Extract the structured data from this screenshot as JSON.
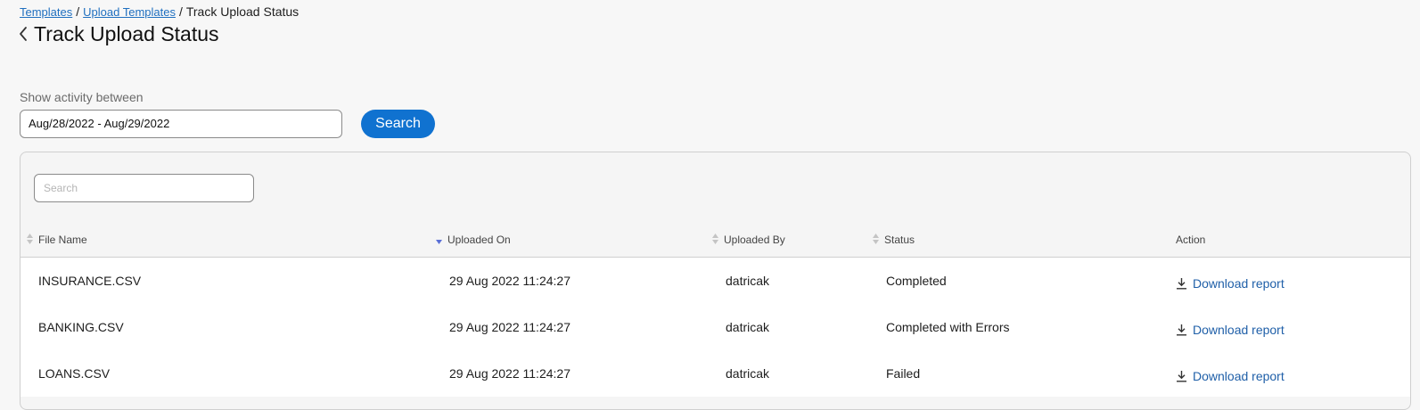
{
  "breadcrumb": {
    "items": [
      "Templates",
      "Upload Templates"
    ],
    "current": "Track Upload Status",
    "separator": "/"
  },
  "page": {
    "title": "Track Upload Status",
    "back_icon": "chevron-left-icon"
  },
  "filter": {
    "label": "Show activity between",
    "date_range": "Aug/28/2022 - Aug/29/2022",
    "search_label": "Search"
  },
  "table": {
    "search_placeholder": "Search",
    "columns": [
      {
        "label": "File Name",
        "sortable": true,
        "sort": "none"
      },
      {
        "label": "Uploaded On",
        "sortable": true,
        "sort": "desc"
      },
      {
        "label": "Uploaded By",
        "sortable": true,
        "sort": "none"
      },
      {
        "label": "Status",
        "sortable": true,
        "sort": "none"
      },
      {
        "label": "Action",
        "sortable": false,
        "sort": "none"
      }
    ],
    "rows": [
      {
        "file_name": "INSURANCE.CSV",
        "uploaded_on": "29 Aug 2022 11:24:27",
        "uploaded_by": "datricak",
        "status": "Completed",
        "action": "Download report"
      },
      {
        "file_name": "BANKING.CSV",
        "uploaded_on": "29 Aug 2022 11:24:27",
        "uploaded_by": "datricak",
        "status": "Completed with Errors",
        "action": "Download report"
      },
      {
        "file_name": "LOANS.CSV",
        "uploaded_on": "29 Aug 2022 11:24:27",
        "uploaded_by": "datricak",
        "status": "Failed",
        "action": "Download report"
      }
    ]
  },
  "colors": {
    "accent": "#1072d0",
    "link": "#1f5fa8",
    "sort_active": "#5a6fd6",
    "sort_inactive": "#c4c4c4"
  }
}
